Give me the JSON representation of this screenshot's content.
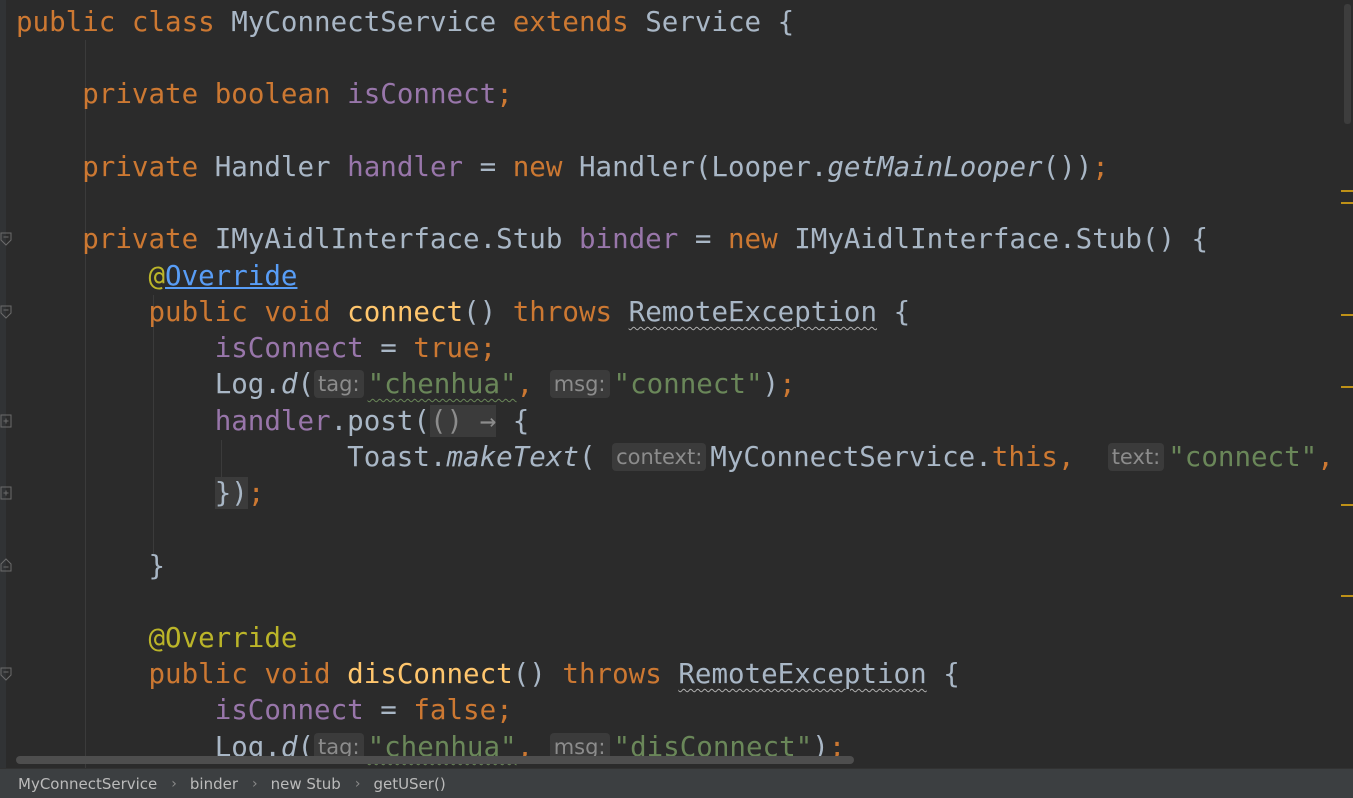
{
  "editor": {
    "hints": {
      "tag": "tag:",
      "msg": "msg:",
      "context": "context:",
      "text": "text:"
    },
    "tokens": {
      "public": "public",
      "class": "class",
      "class_name": "MyConnectService",
      "extends": "extends",
      "service": "Service",
      "open_brace": "{",
      "close_brace": "}",
      "private": "private",
      "boolean": "boolean",
      "is_connect": "isConnect",
      "semicolon": ";",
      "handler_type": "Handler",
      "handler_field": "handler",
      "assign": " = ",
      "new": "new",
      "handler_ctor": "Handler(Looper.",
      "get_main_looper": "getMainLooper",
      "ctor_close": "())",
      "stub_type": "IMyAidlInterface.Stub",
      "binder": "binder",
      "stub_ctor": "IMyAidlInterface.Stub() {",
      "at": "@",
      "override": "Override",
      "at_override": "@Override",
      "void": "void",
      "connect_method": "connect",
      "parens": "()",
      "throws": "throws",
      "remote_exception": "RemoteException",
      "true": "true",
      "false": "false",
      "log": "Log.",
      "d": "d",
      "open_paren": "(",
      "chenhua": "\"chenhua\"",
      "comma": ",",
      "connect_str": "\"connect\"",
      "close_paren_semi": ")",
      "post": ".post(",
      "lambda": "() →",
      "toast": "Toast.",
      "make_text": "makeText",
      "service_ref": "MyConnectService.",
      "this": "this",
      "comma_space": ", ",
      "close_lambda": "})",
      "disconnect_method": "disConnect",
      "disconnect_str": "\"disConnect\""
    }
  },
  "breadcrumb": {
    "items": [
      "MyConnectService",
      "binder",
      "new Stub",
      "getUSer()"
    ],
    "separator": "›"
  },
  "colors": {
    "background": "#2b2b2b",
    "keyword": "#cc7832",
    "field": "#9876aa",
    "method": "#ffc66d",
    "string": "#6a8759",
    "annotation": "#bbb529",
    "default_text": "#a9b7c6",
    "link": "#589df6",
    "marker": "#be9117"
  },
  "icons": [
    "fold-open-icon",
    "fold-closed-icon",
    "breadcrumb-chevron-icon"
  ]
}
